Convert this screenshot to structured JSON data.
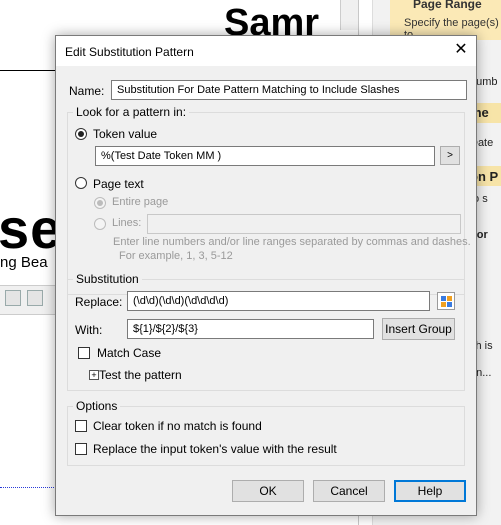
{
  "background": {
    "samr_text": "Samr",
    "se_text": "se",
    "ng_text": "ng Bea",
    "right_panel": {
      "title": "Page Range",
      "description": "Specify the page(s) to",
      "snippets": [
        "numb",
        "me",
        "Date",
        "on P",
        "to s",
        "For",
        "ch is",
        "on..."
      ]
    }
  },
  "dialog": {
    "title": "Edit Substitution Pattern",
    "name_label": "Name:",
    "name_value": "Substitution For Date Pattern Matching to Include Slashes",
    "lookfor": {
      "legend": "Look for a pattern in:",
      "token_value_label": "Token value",
      "token_value": "%(Test Date Token MM )",
      "browse_label": ">",
      "page_text_label": "Page text",
      "entire_page_label": "Entire page",
      "lines_label": "Lines:",
      "lines_value": "",
      "hint_line1": "Enter line numbers and/or line ranges separated by commas and dashes.",
      "hint_line2": "For example, 1, 3, 5-12"
    },
    "substitution": {
      "legend": "Substitution",
      "replace_label": "Replace:",
      "replace_value": "(\\d\\d)(\\d\\d)(\\d\\d\\d\\d)",
      "with_label": "With:",
      "with_value": "${1}/${2}/${3}",
      "insert_group_label": "Insert Group",
      "match_case_label": "Match Case",
      "test_pattern_label": "Test the pattern",
      "expander_symbol": "+"
    },
    "options": {
      "legend": "Options",
      "clear_token_label": "Clear token if no match is found",
      "replace_input_label": "Replace the input token's value with the result"
    },
    "buttons": {
      "ok": "OK",
      "cancel": "Cancel",
      "help": "Help"
    },
    "close_symbol": "✕"
  }
}
